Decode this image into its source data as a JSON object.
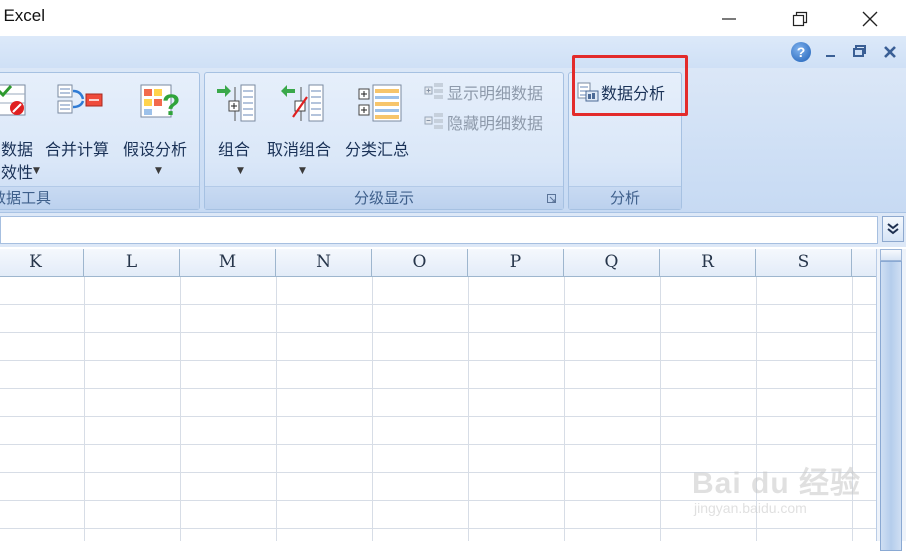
{
  "window": {
    "title": ": Excel"
  },
  "ribbon": {
    "data_tools": {
      "label": "数据工具",
      "validation_line1": "数据",
      "validation_line2": "效性",
      "consolidate": "合并计算",
      "what_if": "假设分析"
    },
    "outline": {
      "label": "分级显示",
      "group": "组合",
      "ungroup": "取消组合",
      "subtotal": "分类汇总",
      "show_detail": "显示明细数据",
      "hide_detail": "隐藏明细数据"
    },
    "analysis": {
      "label": "分析",
      "data_analysis": "数据分析"
    }
  },
  "sheet": {
    "columns": [
      "K",
      "L",
      "M",
      "N",
      "O",
      "P",
      "Q",
      "R",
      "S"
    ]
  },
  "watermark": {
    "brand": "Bai du 经验",
    "url": "jingyan.baidu.com"
  },
  "colors": {
    "highlight": "#e32b2b",
    "ribbon_bg": "#dbe7f7"
  }
}
